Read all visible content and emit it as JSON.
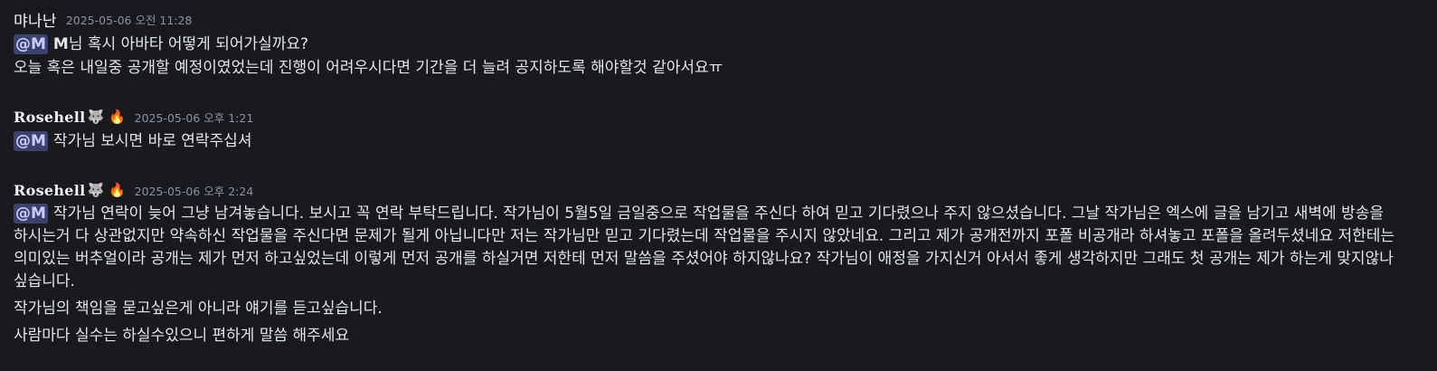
{
  "messages": [
    {
      "author": "먀나난",
      "timestamp": "2025-05-06 오전 11:28",
      "mention": "@M",
      "mention_name": "M",
      "line1_rest": "님 혹시 아바타 어떻게 되어가실까요?",
      "line2": "오늘 혹은 내일중 공개할 예정이였었는데 진행이 어려우시다면 기간을 더 늘려 공지하도록 해야할것 같아서요ㅠ"
    },
    {
      "author": "Rosehell",
      "badges": "🐺 🔥",
      "timestamp": "2025-05-06 오후 1:21",
      "mention": "@M",
      "text": "작가님 보시면 바로 연락주십셔"
    },
    {
      "author": "Rosehell",
      "badges": "🐺 🔥",
      "timestamp": "2025-05-06 오후 2:24",
      "mention": "@M",
      "paragraph": "작가님 연락이 늦어 그냥 남겨놓습니다. 보시고 꼭 연락 부탁드립니다. 작가님이 5월5일 금일중으로 작업물을 주신다 하여 믿고 기다렸으나 주지 않으셨습니다. 그날 작가님은 엑스에 글을 남기고 새벽에 방송을 하시는거 다 상관없지만 약속하신 작업물을 주신다면 문제가 될게 아닙니다만 저는 작가님만 믿고 기다렸는데 작업물을 주시지 않았네요. 그리고 제가 공개전까지 포폴 비공개라 하셔놓고 포폴을 올려두셨네요 저한테는 의미있는 버추얼이라 공개는 제가 먼저 하고싶었는데 이렇게 먼저 공개를 하실거면 저한테 먼저 말씀을 주셨어야 하지않나요? 작가님이 애정을 가지신거 아서서 좋게 생각하지만 그래도 첫 공개는 제가 하는게 맞지않나 싶습니다.",
      "line2": "작가님의 책임을 묻고싶은게 아니라 얘기를 듣고싶습니다.",
      "line3": "사람마다 실수는 하실수있으니 편하게 말씀 해주세요"
    }
  ]
}
